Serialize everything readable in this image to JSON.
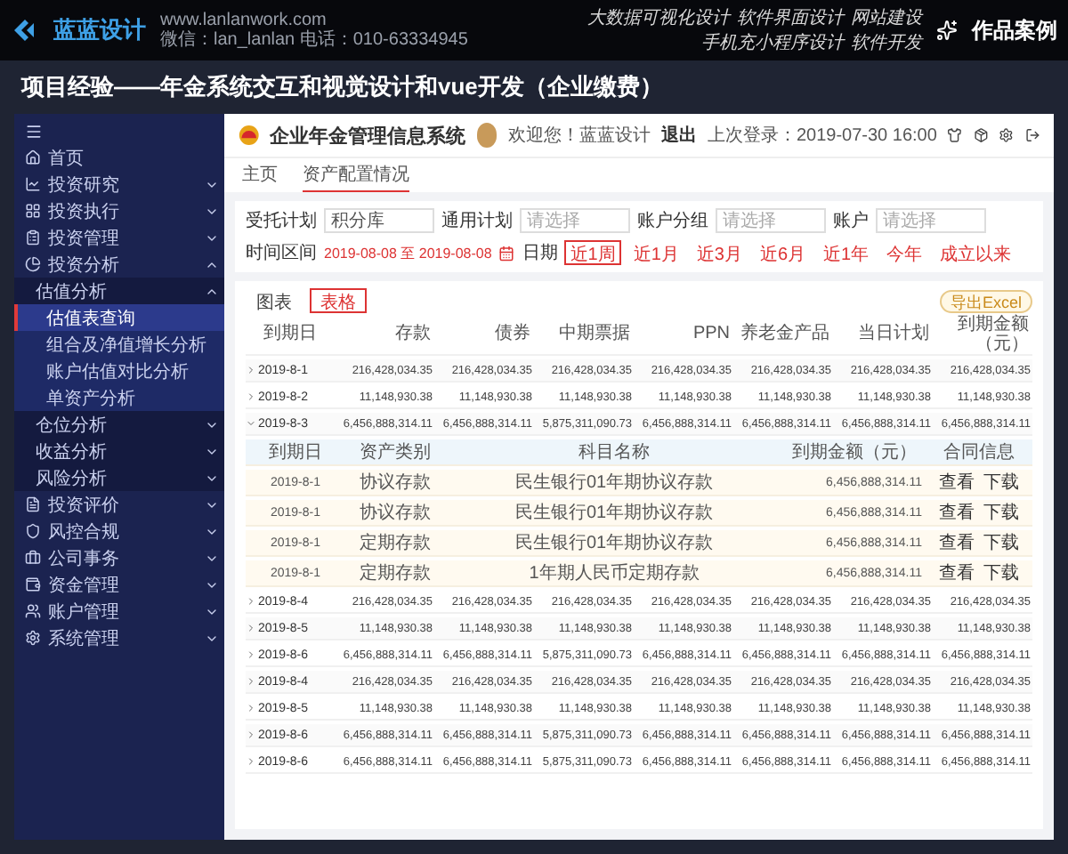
{
  "header": {
    "logo_text": "蓝蓝设计",
    "site": "www.lanlanwork.com",
    "contact": "微信：lan_lanlan  电话：010-63334945",
    "nav": [
      "大数据可视化设计",
      "软件界面设计",
      "网站建设",
      "手机充小程序设计",
      "软件开发"
    ],
    "cases_label": "作品案例"
  },
  "title": "项目经验——年金系统交互和视觉设计和vue开发（企业缴费）",
  "app": {
    "system_name": "企业年金管理信息系统",
    "greeting": "欢迎您！蓝蓝设计",
    "logout": "退出",
    "last_login": "上次登录：2019-07-30 16:00"
  },
  "page_tabs": [
    {
      "label": "主页",
      "selected": false
    },
    {
      "label": "资产配置情况",
      "selected": true
    }
  ],
  "sidebar": {
    "items": [
      {
        "label": "首页",
        "selected": false
      },
      {
        "label": "投资研究",
        "selected": false,
        "expanded": false
      },
      {
        "label": "投资执行",
        "selected": false,
        "expanded": false
      },
      {
        "label": "投资管理",
        "selected": false,
        "expanded": false
      },
      {
        "label": "投资分析",
        "selected": false,
        "expanded": true,
        "children": [
          {
            "label": "估值分析",
            "selected": false,
            "expanded": true,
            "children": [
              {
                "label": "估值表查询",
                "selected": true
              },
              {
                "label": "组合及净值增长分析",
                "selected": false
              },
              {
                "label": "账户估值对比分析",
                "selected": false
              },
              {
                "label": "单资产分析",
                "selected": false
              }
            ]
          },
          {
            "label": "仓位分析",
            "selected": false,
            "expanded": false
          },
          {
            "label": "收益分析",
            "selected": false,
            "expanded": false
          },
          {
            "label": "风险分析",
            "selected": false,
            "expanded": false
          }
        ]
      },
      {
        "label": "投资评价",
        "selected": false,
        "expanded": false
      },
      {
        "label": "风控合规",
        "selected": false,
        "expanded": false
      },
      {
        "label": "公司事务",
        "selected": false,
        "expanded": false
      },
      {
        "label": "资金管理",
        "selected": false,
        "expanded": false
      },
      {
        "label": "账户管理",
        "selected": false,
        "expanded": false
      },
      {
        "label": "系统管理",
        "selected": false,
        "expanded": false
      }
    ]
  },
  "filters": {
    "fields": [
      {
        "label": "受托计划",
        "value": "积分库"
      },
      {
        "label": "通用计划",
        "placeholder": "请选择"
      },
      {
        "label": "账户分组",
        "placeholder": "请选择"
      },
      {
        "label": "账户",
        "placeholder": "请选择"
      }
    ],
    "range_label": "时间区间",
    "range_value": "2019-08-08 至 2019-08-08",
    "date_label": "日期",
    "quick_ranges": [
      {
        "label": "近1周",
        "selected": true
      },
      {
        "label": "近1月",
        "selected": false
      },
      {
        "label": "近3月",
        "selected": false
      },
      {
        "label": "近6月",
        "selected": false
      },
      {
        "label": "近1年",
        "selected": false
      },
      {
        "label": "今年",
        "selected": false
      },
      {
        "label": "成立以来",
        "selected": false
      }
    ]
  },
  "view_tabs": [
    {
      "label": "图表",
      "selected": false
    },
    {
      "label": "表格",
      "selected": true
    }
  ],
  "export_label": "导出Excel",
  "table": {
    "columns": [
      "到期日",
      "存款",
      "债券",
      "中期票据",
      "PPN",
      "养老金产品",
      "当日计划",
      "到期金额（元）"
    ],
    "rows": [
      {
        "expanded": false,
        "cells": [
          "2019-8-1",
          "216,428,034.35",
          "216,428,034.35",
          "216,428,034.35",
          "216,428,034.35",
          "216,428,034.35",
          "216,428,034.35",
          "216,428,034.35"
        ]
      },
      {
        "expanded": false,
        "cells": [
          "2019-8-2",
          "11,148,930.38",
          "11,148,930.38",
          "11,148,930.38",
          "11,148,930.38",
          "11,148,930.38",
          "11,148,930.38",
          "11,148,930.38"
        ]
      },
      {
        "expanded": true,
        "cells": [
          "2019-8-3",
          "6,456,888,314.11",
          "6,456,888,314.11",
          "5,875,311,090.73",
          "6,456,888,314.11",
          "6,456,888,314.11",
          "6,456,888,314.11",
          "6,456,888,314.11"
        ],
        "details": {
          "columns": [
            "到期日",
            "资产类别",
            "科目名称",
            "到期金额（元）",
            "合同信息"
          ],
          "rows": [
            {
              "date": "2019-8-1",
              "category": "协议存款",
              "subject": "民生银行01年期协议存款",
              "amount": "6,456,888,314.11",
              "actions": [
                "查看",
                "下载"
              ]
            },
            {
              "date": "2019-8-1",
              "category": "协议存款",
              "subject": "民生银行01年期协议存款",
              "amount": "6,456,888,314.11",
              "actions": [
                "查看",
                "下载"
              ]
            },
            {
              "date": "2019-8-1",
              "category": "定期存款",
              "subject": "民生银行01年期协议存款",
              "amount": "6,456,888,314.11",
              "actions": [
                "查看",
                "下载"
              ]
            },
            {
              "date": "2019-8-1",
              "category": "定期存款",
              "subject": "1年期人民币定期存款",
              "amount": "6,456,888,314.11",
              "actions": [
                "查看",
                "下载"
              ]
            }
          ]
        }
      },
      {
        "expanded": false,
        "cells": [
          "2019-8-4",
          "216,428,034.35",
          "216,428,034.35",
          "216,428,034.35",
          "216,428,034.35",
          "216,428,034.35",
          "216,428,034.35",
          "216,428,034.35"
        ]
      },
      {
        "expanded": false,
        "cells": [
          "2019-8-5",
          "11,148,930.38",
          "11,148,930.38",
          "11,148,930.38",
          "11,148,930.38",
          "11,148,930.38",
          "11,148,930.38",
          "11,148,930.38"
        ]
      },
      {
        "expanded": false,
        "cells": [
          "2019-8-6",
          "6,456,888,314.11",
          "6,456,888,314.11",
          "5,875,311,090.73",
          "6,456,888,314.11",
          "6,456,888,314.11",
          "6,456,888,314.11",
          "6,456,888,314.11"
        ]
      },
      {
        "expanded": false,
        "cells": [
          "2019-8-4",
          "216,428,034.35",
          "216,428,034.35",
          "216,428,034.35",
          "216,428,034.35",
          "216,428,034.35",
          "216,428,034.35",
          "216,428,034.35"
        ]
      },
      {
        "expanded": false,
        "cells": [
          "2019-8-5",
          "11,148,930.38",
          "11,148,930.38",
          "11,148,930.38",
          "11,148,930.38",
          "11,148,930.38",
          "11,148,930.38",
          "11,148,930.38"
        ]
      },
      {
        "expanded": false,
        "cells": [
          "2019-8-6",
          "6,456,888,314.11",
          "6,456,888,314.11",
          "5,875,311,090.73",
          "6,456,888,314.11",
          "6,456,888,314.11",
          "6,456,888,314.11",
          "6,456,888,314.11"
        ]
      },
      {
        "expanded": false,
        "cells": [
          "2019-8-6",
          "6,456,888,314.11",
          "6,456,888,314.11",
          "5,875,311,090.73",
          "6,456,888,314.11",
          "6,456,888,314.11",
          "6,456,888,314.11",
          "6,456,888,314.11"
        ]
      }
    ]
  }
}
